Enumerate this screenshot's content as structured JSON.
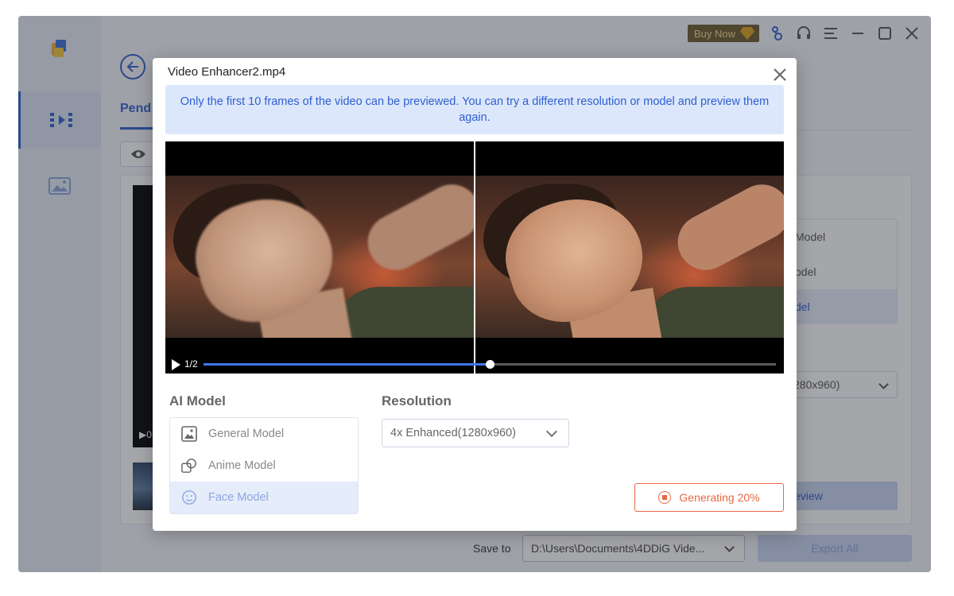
{
  "app": {
    "topbar": {
      "buy_now": "Buy Now"
    },
    "tabs": {
      "pending": "Pend"
    },
    "background_panel": {
      "models": [
        "Model",
        "odel",
        "del"
      ],
      "resolution_partial": "280x960)",
      "preview_partial": "eview",
      "save_to_label": "Save to",
      "save_path": "D:\\Users\\Documents\\4DDiG Vide...",
      "export_all": "Export All",
      "video_time_partial": "▶0"
    },
    "colors": {
      "accent": "#2f5fd0",
      "warning": "#e86843",
      "selected_row": "#e5ecfa"
    }
  },
  "modal": {
    "title": "Video Enhancer2.mp4",
    "notice": "Only the first 10 frames of the video can be previewed. You can try a different resolution or model and preview them again.",
    "player": {
      "frame_counter": "1/2",
      "progress": 0.5
    },
    "ai_model": {
      "label": "AI Model",
      "options": [
        {
          "label": "General Model",
          "icon": "image-icon"
        },
        {
          "label": "Anime Model",
          "icon": "anime-icon"
        },
        {
          "label": "Face Model",
          "icon": "face-icon",
          "selected": true
        }
      ]
    },
    "resolution": {
      "label": "Resolution",
      "value": "4x Enhanced(1280x960)"
    },
    "generating": {
      "label": "Generating 20%",
      "percent": 20
    }
  }
}
